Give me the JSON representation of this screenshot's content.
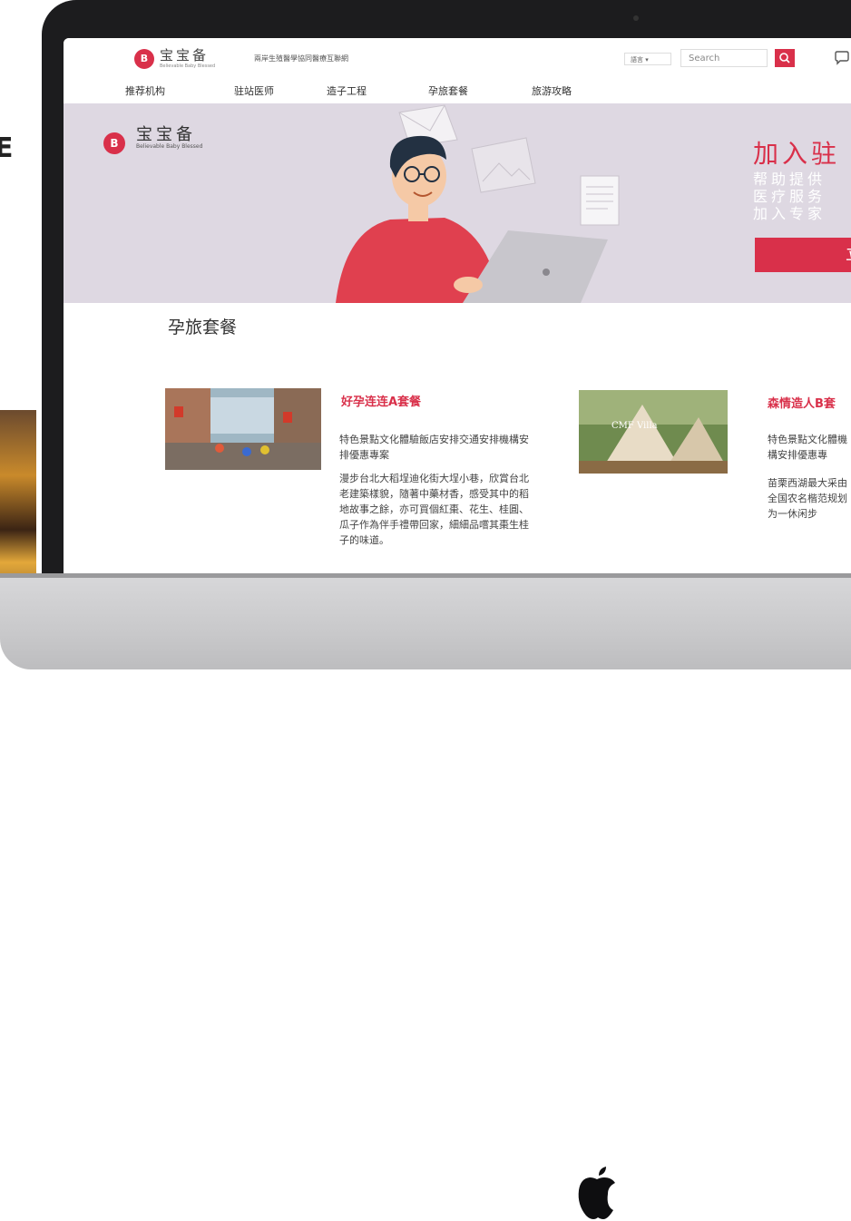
{
  "left_text": "E",
  "header": {
    "logo_mark": "B",
    "logo_cn": "宝宝备",
    "logo_en": "Believable Baby Blessed",
    "tagline": "兩岸生殖醫學協同醫療互聯網",
    "lang_label": "語言 ▾",
    "search_placeholder": "Search"
  },
  "nav": {
    "items": [
      {
        "label": "推荐机构"
      },
      {
        "label": "驻站医师"
      },
      {
        "label": "造子工程"
      },
      {
        "label": "孕旅套餐"
      },
      {
        "label": "旅游攻略"
      }
    ]
  },
  "banner": {
    "logo_mark": "B",
    "logo_cn": "宝宝备",
    "logo_en": "Believable Baby Blessed",
    "title": "加入驻",
    "sub_lines": [
      "帮助提供",
      "医疗服务",
      "加入专家"
    ],
    "button_label": "立"
  },
  "section": {
    "title": "孕旅套餐",
    "cards": [
      {
        "title": "好孕连连A套餐",
        "p1": "特色景點文化體驗飯店安排交通安排機構安排優惠專案",
        "p2": "漫步台北大稻埕迪化街大埕小巷，欣賞台北老建築樣貌，隨著中藥材香，感受其中的稻地故事之餘，亦可買個紅棗、花生、桂圓、瓜子作為伴手禮帶回家，細細品嚐其棗生桂子的味道。"
      },
      {
        "title": "森情造人B套",
        "p1": "特色景點文化體機構安排優惠專",
        "p2": "苗栗西湖最大采由全国农名楷范规划为一休闲步",
        "image_caption": "CMF Villa"
      }
    ]
  },
  "colors": {
    "accent": "#d9304a",
    "banner_bg": "#ded8e2",
    "bezel": "#1c1c1e"
  }
}
